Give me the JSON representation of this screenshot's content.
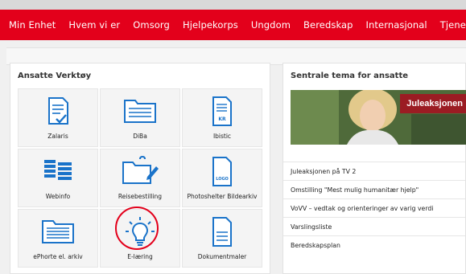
{
  "nav": {
    "items": [
      "Min Enhet",
      "Hvem vi er",
      "Omsorg",
      "Hjelpekorps",
      "Ungdom",
      "Beredskap",
      "Internasjonal",
      "Tjenester"
    ]
  },
  "left_panel": {
    "title": "Ansatte Verktøy",
    "tiles": [
      {
        "label": "Zalaris",
        "icon": "document-check-icon"
      },
      {
        "label": "DiBa",
        "icon": "folder-icon"
      },
      {
        "label": "Ibistic",
        "icon": "document-kr-icon",
        "icon_text": "KR"
      },
      {
        "label": "Webinfo",
        "icon": "stacked-documents-icon"
      },
      {
        "label": "Reisebestilling",
        "icon": "folder-pencil-icon"
      },
      {
        "label": "Photoshelter Bildearkiv",
        "icon": "document-logo-icon",
        "icon_text": "LOGO"
      },
      {
        "label": "ePhorte el. arkiv",
        "icon": "archive-folder-icon"
      },
      {
        "label": "E-læring",
        "icon": "lightbulb-icon"
      },
      {
        "label": "Dokumentmaler",
        "icon": "document-lines-icon"
      }
    ]
  },
  "right_panel": {
    "title": "Sentrale tema for ansatte",
    "banner_text": "Juleaksjonen",
    "links": [
      "Juleaksjonen på TV 2",
      "Omstilling \"Mest mulig humanitær hjelp\"",
      "VoVV – vedtak og orienteringer av varig verdi",
      "Varslingsliste",
      "Beredskapsplan"
    ]
  },
  "colors": {
    "brand_red": "#e3001b",
    "icon_blue": "#1a73c9",
    "banner_red": "#9b1c23"
  }
}
